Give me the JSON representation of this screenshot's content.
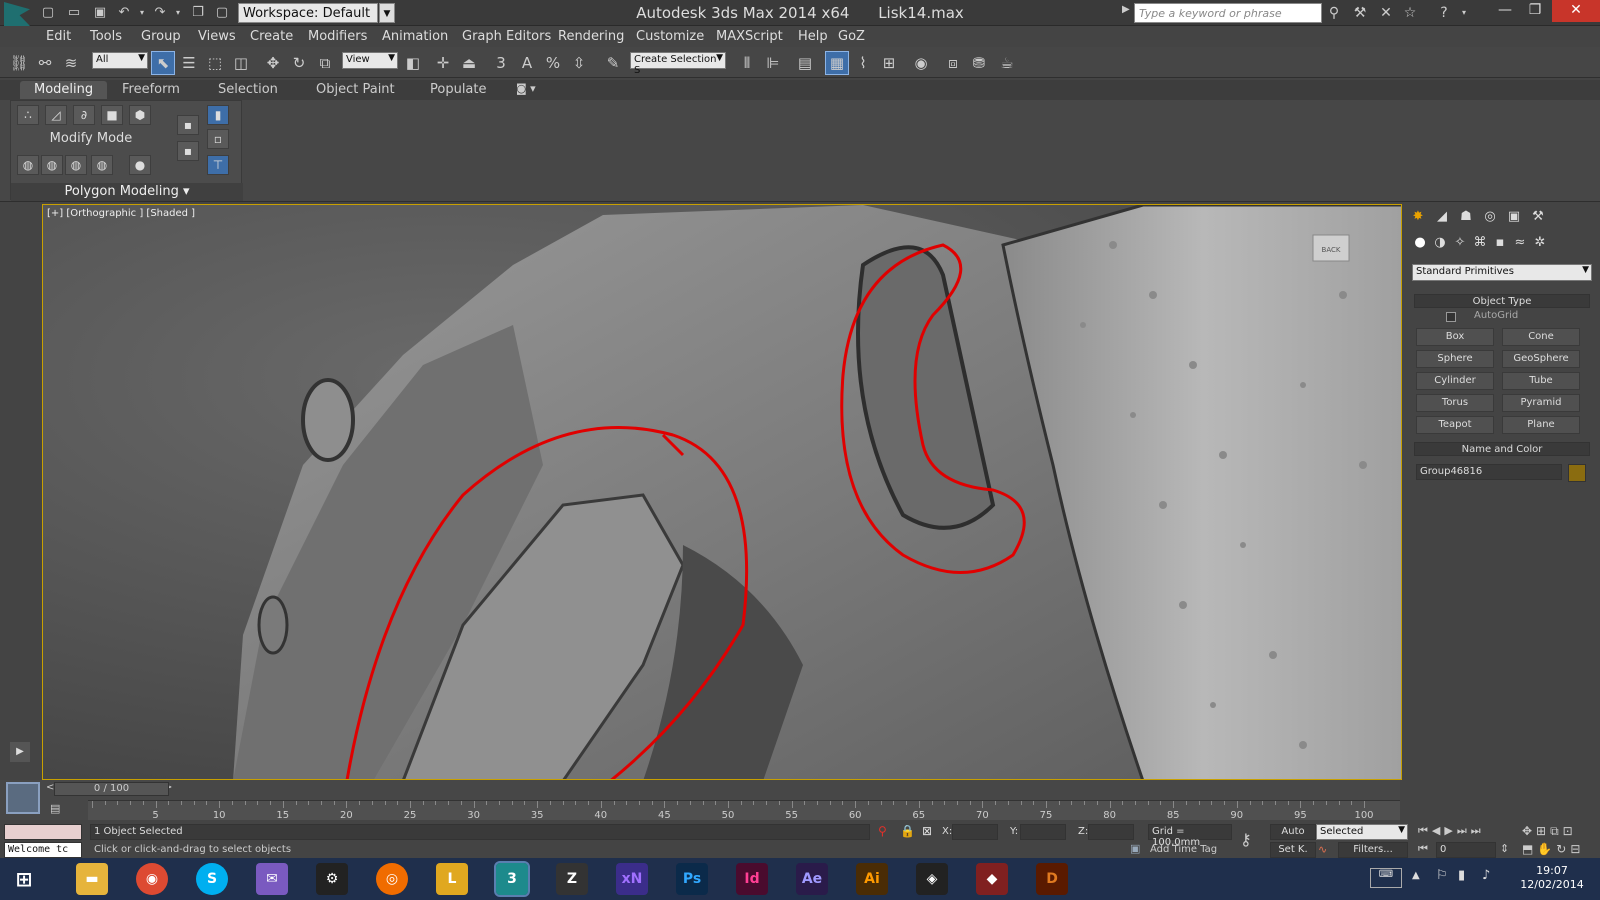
{
  "window": {
    "workspace_label": "Workspace: Default",
    "app_name": "Autodesk 3ds Max  2014 x64",
    "file_name": "Lisk14.max",
    "search_placeholder": "Type a keyword or phrase"
  },
  "menu": [
    "Edit",
    "Tools",
    "Group",
    "Views",
    "Create",
    "Modifiers",
    "Animation",
    "Graph Editors",
    "Rendering",
    "Customize",
    "MAXScript",
    "Help",
    "GoZ"
  ],
  "toolbar": {
    "selection_filter": "All",
    "ref_coord": "View",
    "named_selection": "Create Selection S",
    "snap_value": "3",
    "angle_snap": "A",
    "percent_snap": "%"
  },
  "ribbon": {
    "tabs": [
      "Modeling",
      "Freeform",
      "Selection",
      "Object Paint",
      "Populate"
    ],
    "active_tab": "Modeling",
    "panel_label": "Modify Mode",
    "group_label": "Polygon Modeling"
  },
  "viewport": {
    "label": "[+] [Orthographic ] [Shaded ]",
    "viewcube_label": "BACK"
  },
  "command_panel": {
    "category": "Standard Primitives",
    "object_type_title": "Object Type",
    "autogrid_label": "AutoGrid",
    "primitives": [
      "Box",
      "Cone",
      "Sphere",
      "GeoSphere",
      "Cylinder",
      "Tube",
      "Torus",
      "Pyramid",
      "Teapot",
      "Plane"
    ],
    "name_color_title": "Name and Color",
    "object_name": "Group46816",
    "object_color": "#8a6c10"
  },
  "timeline": {
    "frame_display": "0 / 100",
    "ticks": [
      5,
      10,
      15,
      20,
      25,
      30,
      35,
      40,
      45,
      50,
      55,
      60,
      65,
      70,
      75,
      80,
      85,
      90,
      95,
      100
    ]
  },
  "status": {
    "selection_count": "1 Object Selected",
    "prompt": "Click or click-and-drag to select objects",
    "listener": "Welcome tc",
    "x_label": "X:",
    "y_label": "Y:",
    "z_label": "Z:",
    "grid": "Grid = 100,0mm",
    "add_time_tag": "Add Time Tag",
    "auto_label": "Auto",
    "set_key_label": "Set K.",
    "key_mode": "Selected",
    "filters_label": "Filters...",
    "current_frame": "0"
  },
  "taskbar": {
    "apps": [
      {
        "name": "xN",
        "color": "#3b2d8a"
      },
      {
        "name": "Ps",
        "color": "#0b2a4a"
      },
      {
        "name": "Id",
        "color": "#4a0b2e"
      },
      {
        "name": "Ae",
        "color": "#2a1b4a"
      },
      {
        "name": "Ai",
        "color": "#4a2c05"
      }
    ],
    "time": "19:07",
    "date": "12/02/2014"
  }
}
